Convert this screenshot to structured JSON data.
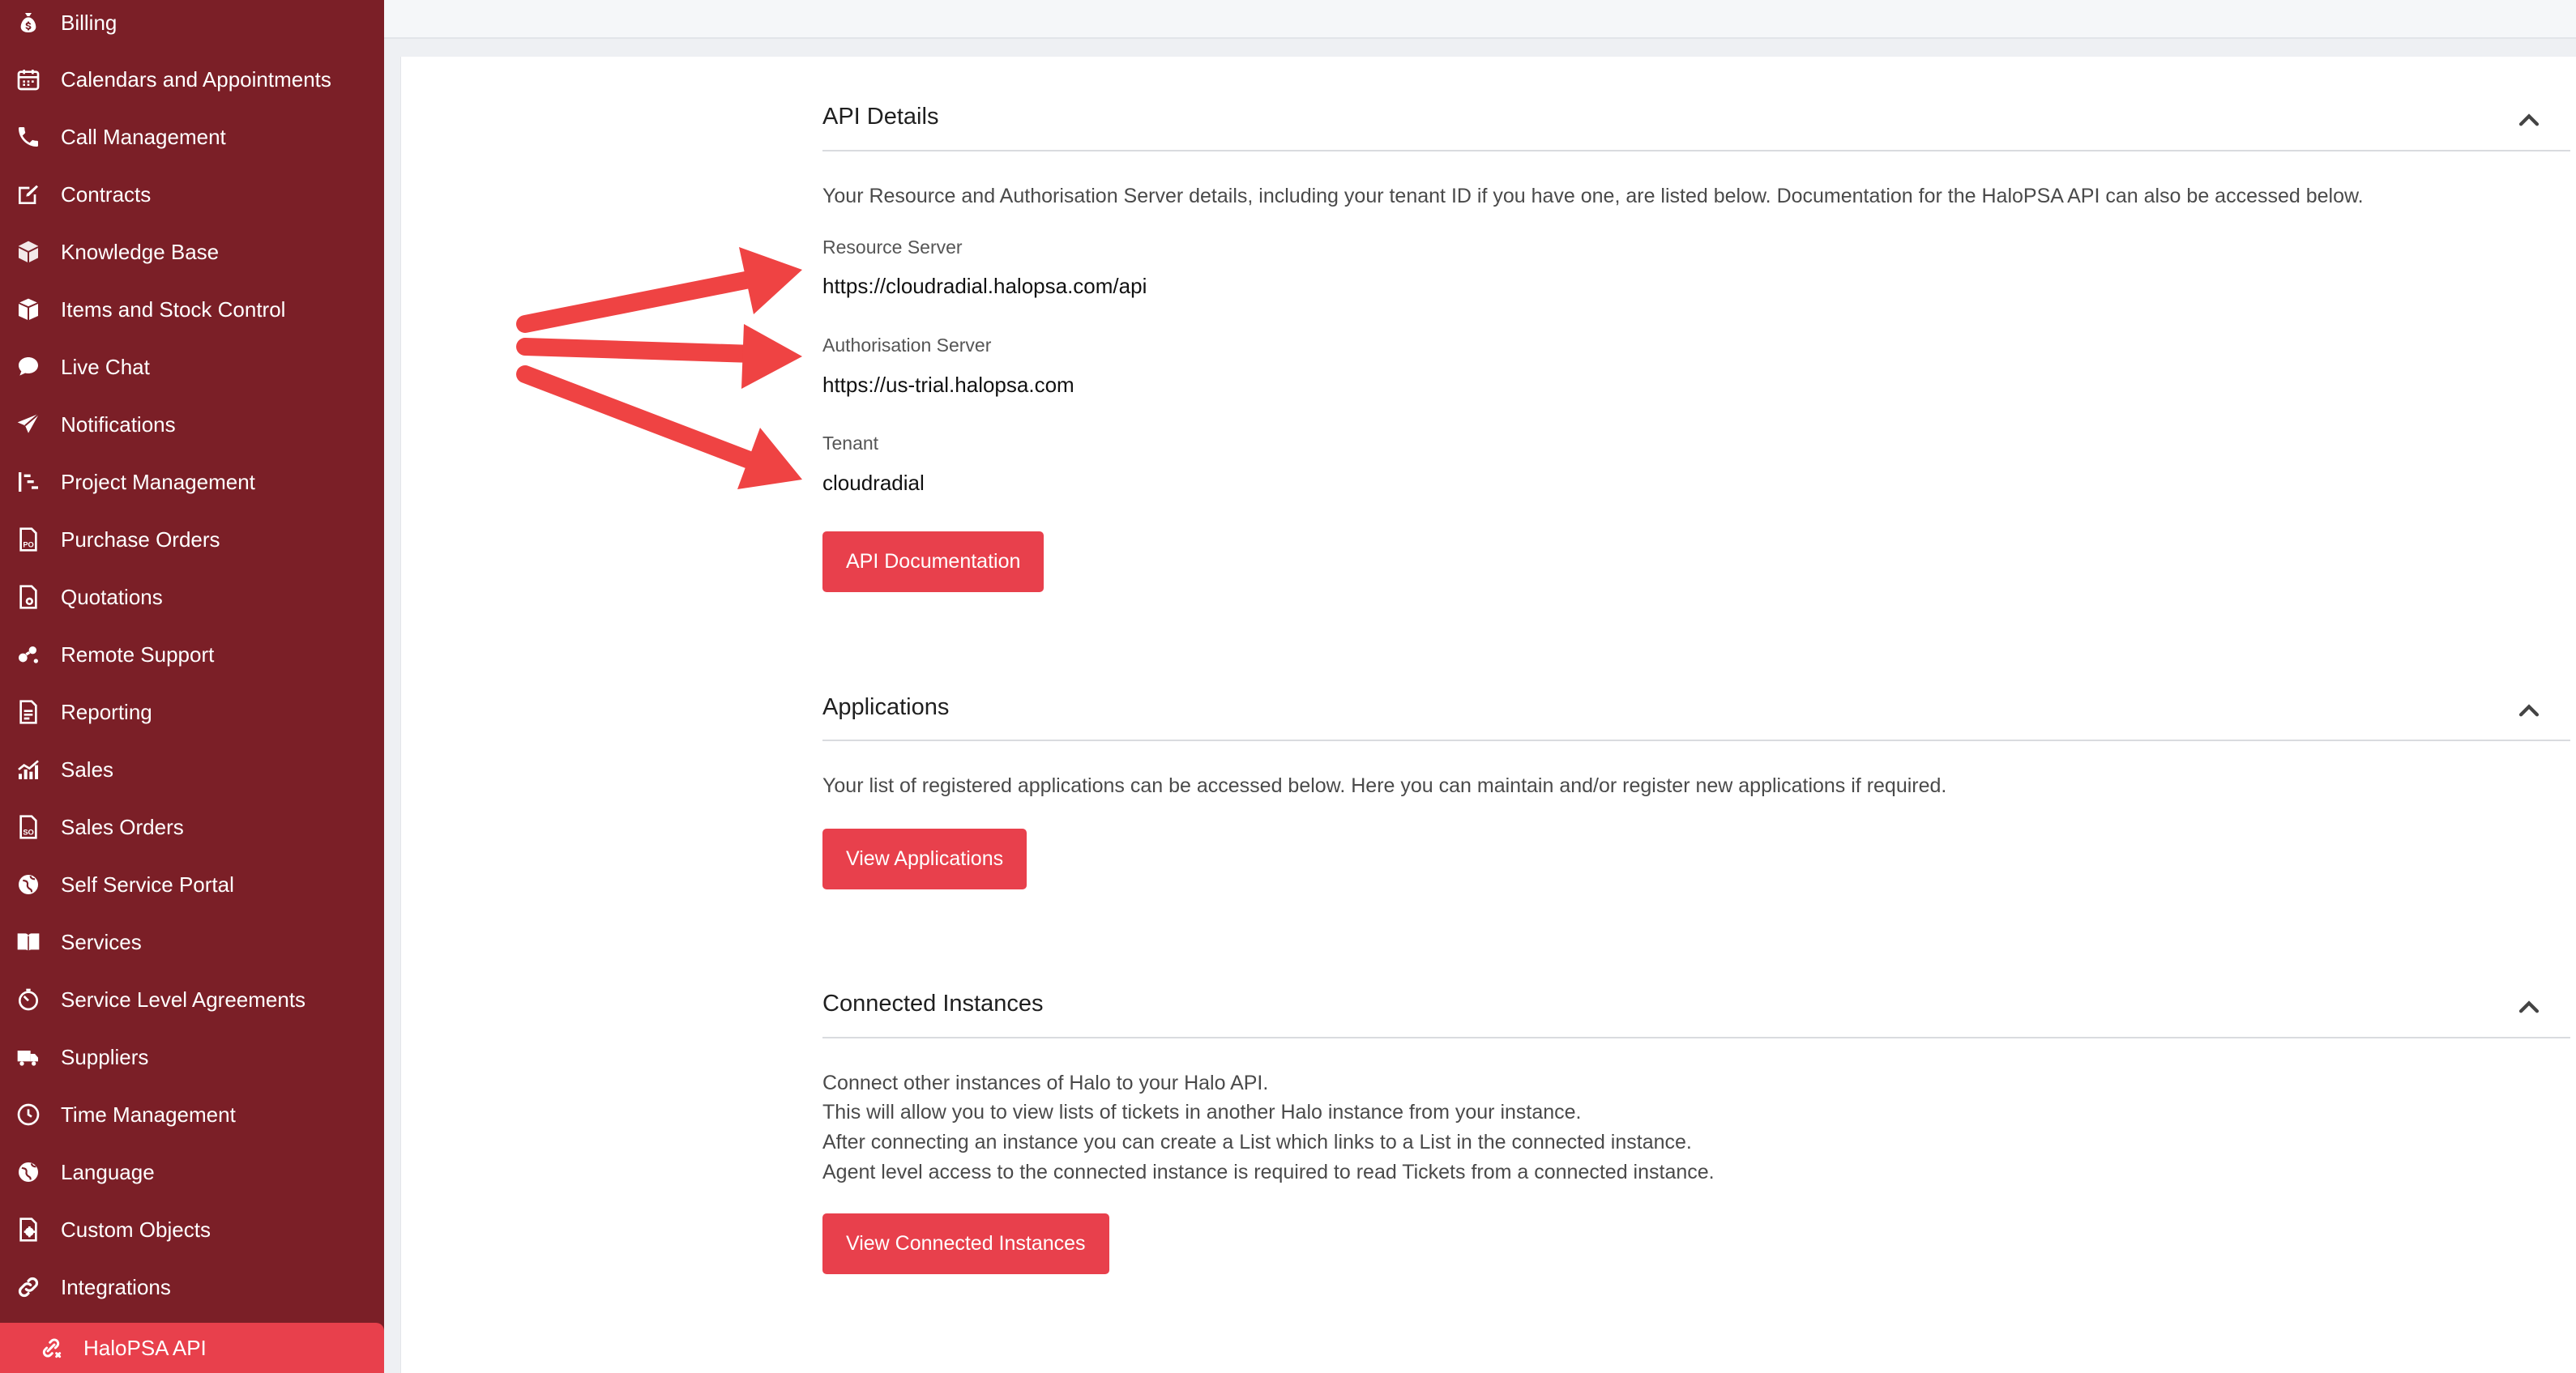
{
  "sidebar": {
    "items": [
      {
        "label": "Billing",
        "icon": "money-bag-icon"
      },
      {
        "label": "Calendars and Appointments",
        "icon": "calendar-icon"
      },
      {
        "label": "Call Management",
        "icon": "phone-icon"
      },
      {
        "label": "Contracts",
        "icon": "contract-edit-icon"
      },
      {
        "label": "Knowledge Base",
        "icon": "book-cube-icon"
      },
      {
        "label": "Items and Stock Control",
        "icon": "box-icon"
      },
      {
        "label": "Live Chat",
        "icon": "chat-bubble-icon"
      },
      {
        "label": "Notifications",
        "icon": "paper-plane-icon"
      },
      {
        "label": "Project Management",
        "icon": "gantt-icon"
      },
      {
        "label": "Purchase Orders",
        "icon": "po-document-icon"
      },
      {
        "label": "Quotations",
        "icon": "quote-document-icon"
      },
      {
        "label": "Remote Support",
        "icon": "remote-link-icon"
      },
      {
        "label": "Reporting",
        "icon": "report-document-icon"
      },
      {
        "label": "Sales",
        "icon": "sales-chart-icon"
      },
      {
        "label": "Sales Orders",
        "icon": "so-document-icon"
      },
      {
        "label": "Self Service Portal",
        "icon": "globe-icon"
      },
      {
        "label": "Services",
        "icon": "open-book-icon"
      },
      {
        "label": "Service Level Agreements",
        "icon": "stopwatch-icon"
      },
      {
        "label": "Suppliers",
        "icon": "truck-icon"
      },
      {
        "label": "Time Management",
        "icon": "clock-icon"
      },
      {
        "label": "Language",
        "icon": "language-globe-icon"
      },
      {
        "label": "Custom Objects",
        "icon": "custom-object-icon"
      },
      {
        "label": "Integrations",
        "icon": "link-icon"
      },
      {
        "label": "HaloPSA API",
        "icon": "api-link-icon",
        "active": true
      }
    ]
  },
  "api_details": {
    "title": "API Details",
    "description": "Your Resource and Authorisation Server details, including your tenant ID if you have one, are listed below. Documentation for the HaloPSA API can also be accessed below.",
    "resource_server_label": "Resource Server",
    "resource_server_value": "https://cloudradial.halopsa.com/api",
    "authorisation_server_label": "Authorisation Server",
    "authorisation_server_value": "https://us-trial.halopsa.com",
    "tenant_label": "Tenant",
    "tenant_value": "cloudradial",
    "button_label": "API Documentation"
  },
  "applications": {
    "title": "Applications",
    "description": "Your list of registered applications can be accessed below. Here you can maintain and/or register new applications if required.",
    "button_label": "View Applications"
  },
  "connected_instances": {
    "title": "Connected Instances",
    "lines": [
      "Connect other instances of Halo to your Halo API.",
      "This will allow you to view lists of tickets in another Halo instance from your instance.",
      "After connecting an instance you can create a List which links to a List in the connected instance.",
      "Agent level access to the connected instance is required to read Tickets from a connected instance."
    ],
    "button_label": "View Connected Instances"
  },
  "colors": {
    "sidebar_bg": "#7b1f27",
    "accent": "#e8404c",
    "annotation_arrow": "#ef4343"
  }
}
